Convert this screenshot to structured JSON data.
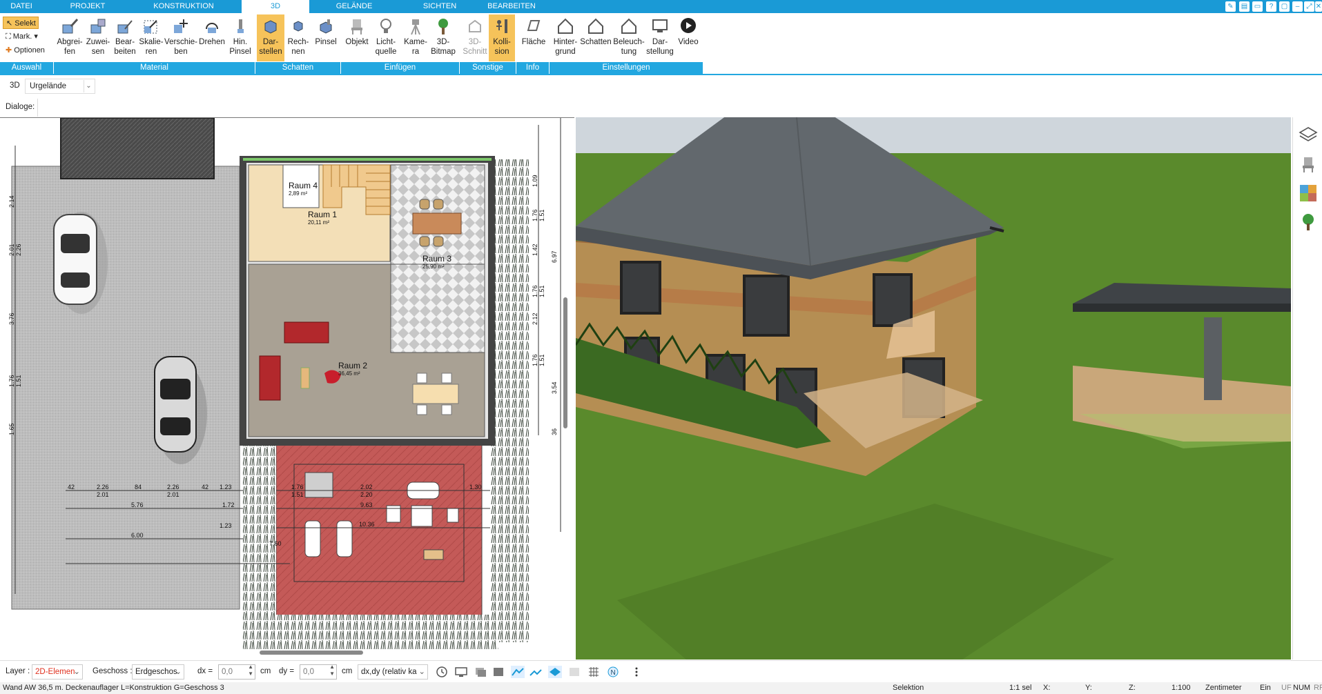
{
  "tabs": [
    "DATEI",
    "PROJEKT",
    "KONSTRUKTION",
    "3D",
    "GELÄNDE",
    "SICHTEN",
    "BEARBEITEN"
  ],
  "active_tab": "3D",
  "selection": {
    "select": "Selekt",
    "mark": "Mark.",
    "options": "Optionen"
  },
  "ribbon": {
    "material": [
      "Abgrei-\nfen",
      "Zuwei-\nsen",
      "Bear-\nbeiten",
      "Skalie-\nren",
      "Verschie-\nben",
      "Drehen",
      "Hin.\nPinsel"
    ],
    "schatten": [
      "Dar-\nstellen",
      "Rech-\nnen",
      "Pinsel"
    ],
    "einfuegen": [
      "Objekt",
      "Licht-\nquelle",
      "Kame-\nra",
      "3D-\nBitmap"
    ],
    "sonstige": [
      "3D-\nSchnitt",
      "Kolli-\nsion"
    ],
    "info": [
      "Fläche"
    ],
    "einstellungen": [
      "Hinter-\ngrund",
      "Schatten",
      "Beleuch-\ntung",
      "Dar-\nstellung",
      "Video"
    ]
  },
  "groups": [
    "Auswahl",
    "Material",
    "Schatten",
    "Einfügen",
    "Sonstige",
    "Info",
    "Einstellungen"
  ],
  "view": {
    "label": "3D",
    "dropdown": "Urgelände"
  },
  "dialog_label": "Dialoge:",
  "plan": {
    "rooms": [
      {
        "name": "Raum 4",
        "area": "2,89 m²"
      },
      {
        "name": "Raum 1",
        "area": "20,11 m²"
      },
      {
        "name": "Raum 3",
        "area": "25,90 m²"
      },
      {
        "name": "Raum 2",
        "area": "36,45 m²"
      }
    ],
    "dims_bottom": [
      "42",
      "2.26",
      "84",
      "2.26",
      "42",
      "1.23",
      "2.01",
      "2.01",
      "5.76",
      "1.72",
      "6.00",
      "1.23",
      "7.60",
      "1.76",
      "2.02",
      "1.30",
      "1.51",
      "2.20",
      "9.63",
      "10.36"
    ],
    "dims_left": [
      "2.14",
      "2.01",
      "2.26",
      "3.76",
      "1.76",
      "1.51",
      "1.65"
    ],
    "dims_right": [
      "1.09",
      "1.76",
      "1.51",
      "1.42",
      "6.97",
      "1.76",
      "1.51",
      "2.12",
      "1.76",
      "1.51",
      "3.54",
      "36"
    ]
  },
  "bottombar": {
    "layer_label": "Layer :",
    "layer_value": "2D-Elemen",
    "geschoss_label": "Geschoss :",
    "geschoss_value": "Erdgeschos",
    "dx_label": "dx =",
    "dx_value": "0,0",
    "dx_unit": "cm",
    "dy_label": "dy =",
    "dy_value": "0,0",
    "dy_unit": "cm",
    "mode_value": "dx,dy (relativ ka"
  },
  "statusbar": {
    "message": "Wand AW 36,5 m. Deckenauflager L=Konstruktion G=Geschoss 3",
    "mode": "Selektion",
    "sel": "1:1 sel",
    "x": "X:",
    "y": "Y:",
    "z": "Z:",
    "scale": "1:100",
    "unit": "Zentimeter",
    "ein": "Ein",
    "uf": "UF",
    "num": "NUM",
    "rf": "RF"
  },
  "colors": {
    "tab_blue": "#1a9ad6",
    "group_blue": "#22a7e0",
    "highlight": "#f6c35a",
    "layer_red": "#e0301e",
    "sky": "#cfd6dc",
    "lawn": "#5a8a2c",
    "roof": "#62686d"
  }
}
